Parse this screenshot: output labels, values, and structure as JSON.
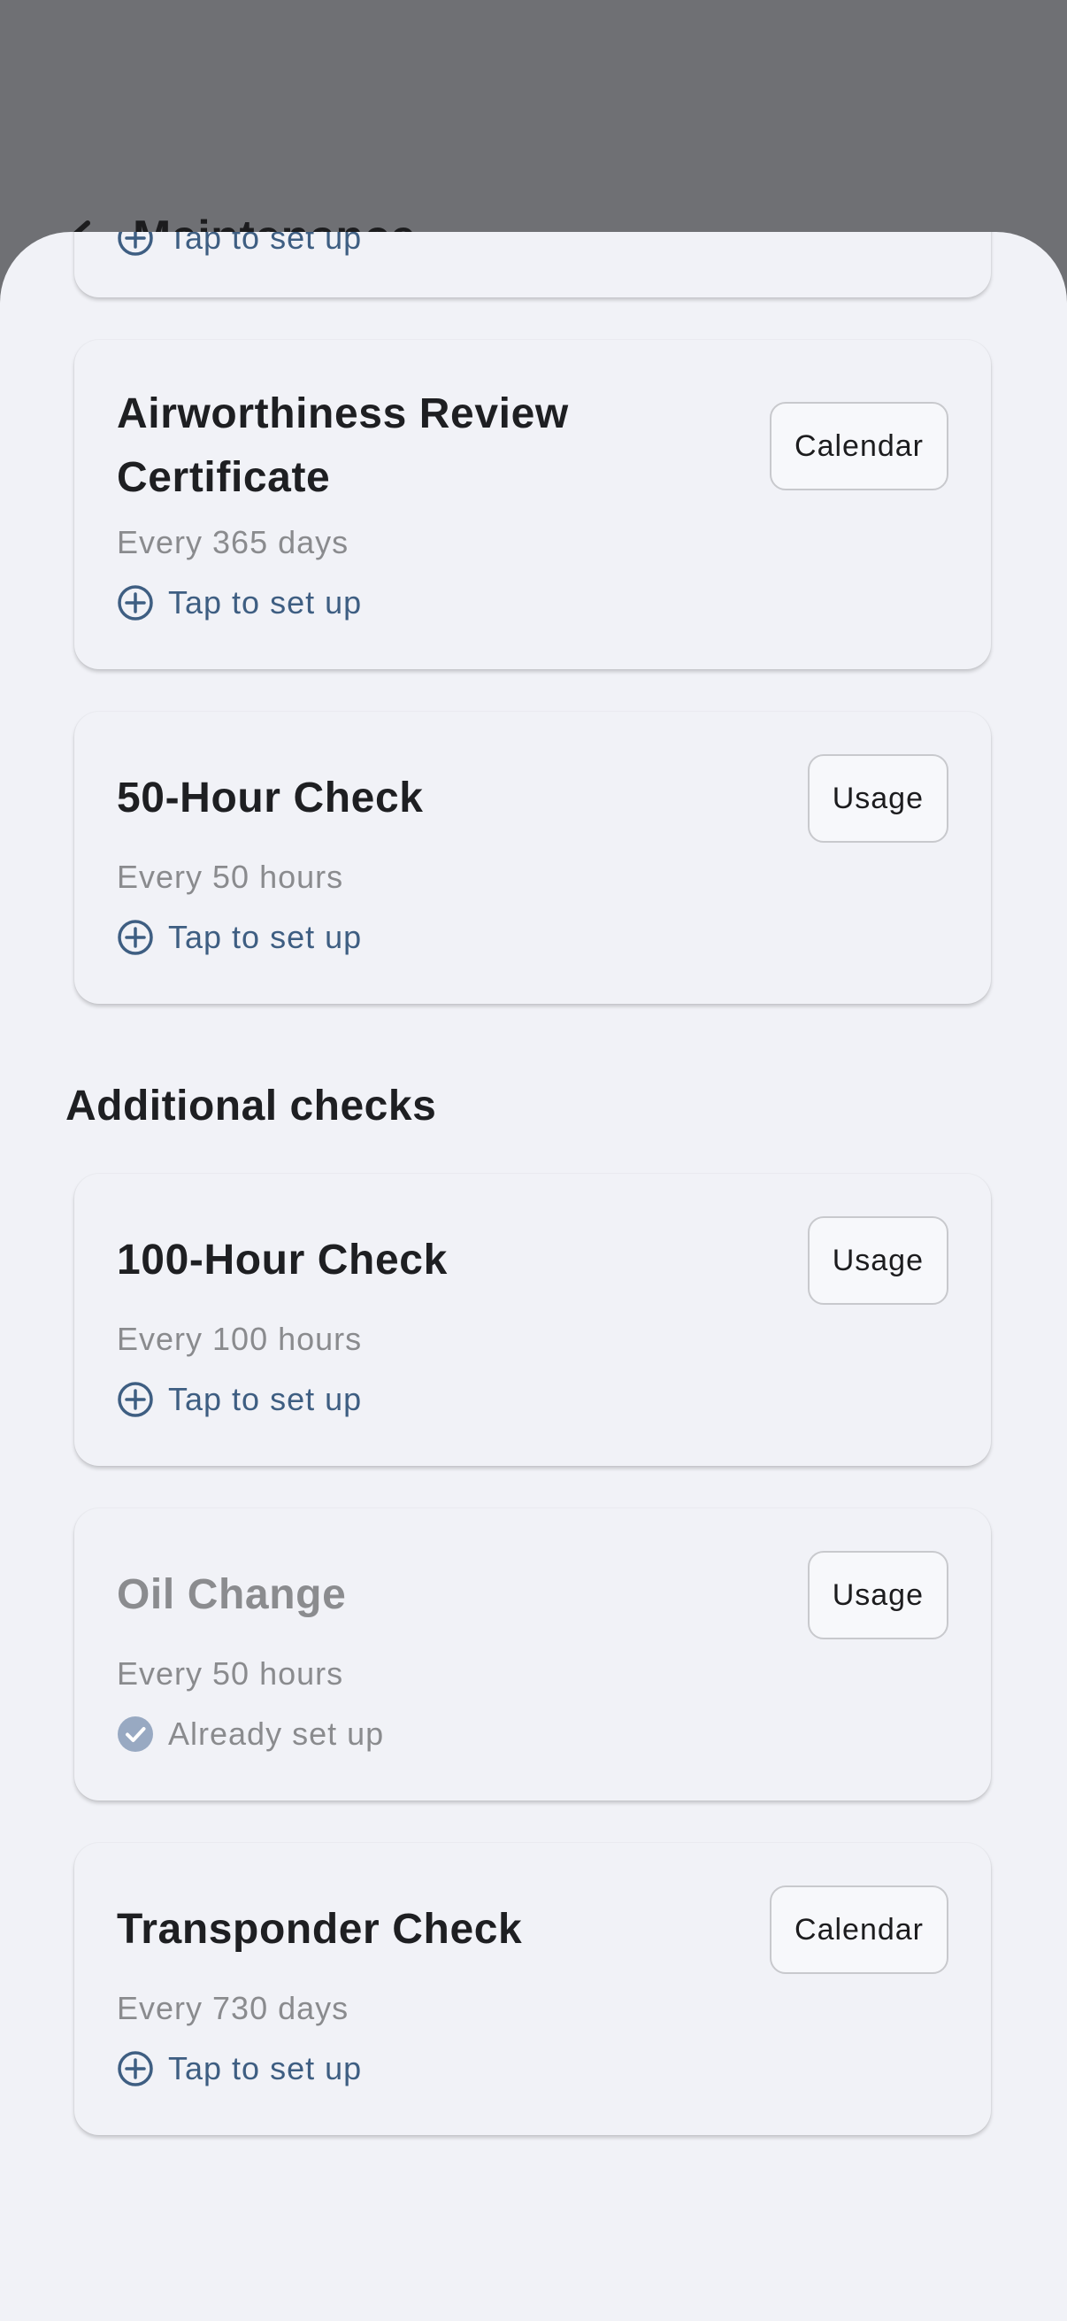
{
  "background": {
    "title": "Maintenance"
  },
  "partial_card": {
    "status": "Tap to set up"
  },
  "primary_checks": [
    {
      "title": "Airworthiness Review Certificate",
      "interval": "Every 365 days",
      "status": "Tap to set up",
      "type": "Calendar"
    },
    {
      "title": "50-Hour Check",
      "interval": "Every 50 hours",
      "status": "Tap to set up",
      "type": "Usage"
    }
  ],
  "additional_heading": "Additional checks",
  "additional_checks": [
    {
      "title": "100-Hour Check",
      "interval": "Every 100 hours",
      "status": "Tap to set up",
      "type": "Usage"
    },
    {
      "title": "Oil Change",
      "interval": "Every 50 hours",
      "status": "Already set up",
      "type": "Usage"
    },
    {
      "title": "Transponder Check",
      "interval": "Every 730 days",
      "status": "Tap to set up",
      "type": "Calendar"
    }
  ],
  "colors": {
    "backdrop": "#6f7074",
    "sheet": "#f1f2f7",
    "accent": "#3e5e82",
    "done_icon": "#98a9c2",
    "muted_text": "#8a8b8e"
  },
  "icons": {
    "back": "chevron-left-icon",
    "setup": "plus-circle-icon",
    "done": "check-circle-icon"
  }
}
